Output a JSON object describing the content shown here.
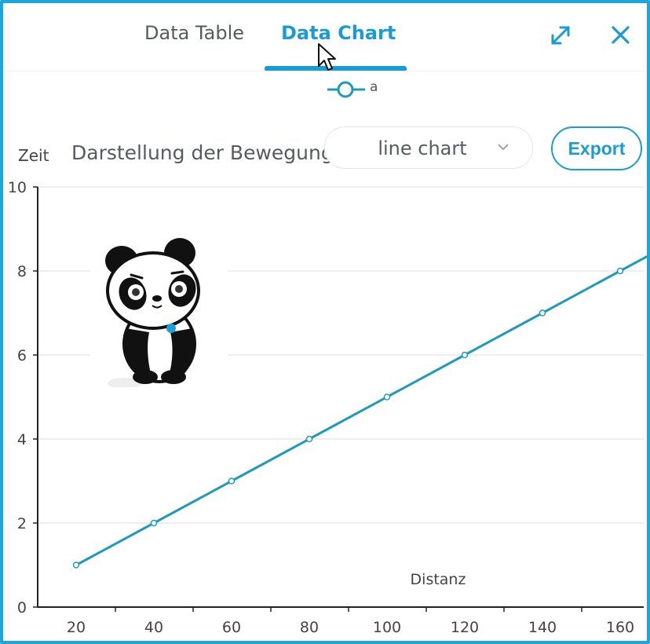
{
  "tabs": [
    {
      "label": "Data Table",
      "active": false
    },
    {
      "label": "Data Chart",
      "active": true
    }
  ],
  "header_icons": [
    "expand-icon",
    "close-icon"
  ],
  "legend": {
    "series_name": "a"
  },
  "toolbar": {
    "y_label": "Zeit",
    "title": "Darstellung der Bewegung",
    "chart_type_select": {
      "value": "line chart"
    },
    "export_label": "Export"
  },
  "colors": {
    "accent": "#1a9bd2",
    "line": "#1e9bb8",
    "frame": "#1ea6dc",
    "grid": "#dcdcdc",
    "text": "#555b61"
  },
  "chart_data": {
    "type": "line",
    "ylabel": "Zeit",
    "xlabel": "Distanz",
    "series": [
      {
        "name": "a",
        "x": [
          20,
          40,
          60,
          80,
          100,
          120,
          140,
          160,
          167
        ],
        "y": [
          1,
          2,
          3,
          4,
          5,
          6,
          7,
          8,
          8.35
        ]
      }
    ],
    "marked_points": 8,
    "x_ticks": [
      20,
      40,
      60,
      80,
      100,
      120,
      140,
      160
    ],
    "y_ticks": [
      0,
      2,
      4,
      6,
      8,
      10
    ],
    "ylim": [
      0,
      10
    ],
    "xlim": [
      10,
      165
    ],
    "grid": "horizontal",
    "legend_position": "top-center"
  },
  "decorations": [
    "panda-sticker"
  ]
}
